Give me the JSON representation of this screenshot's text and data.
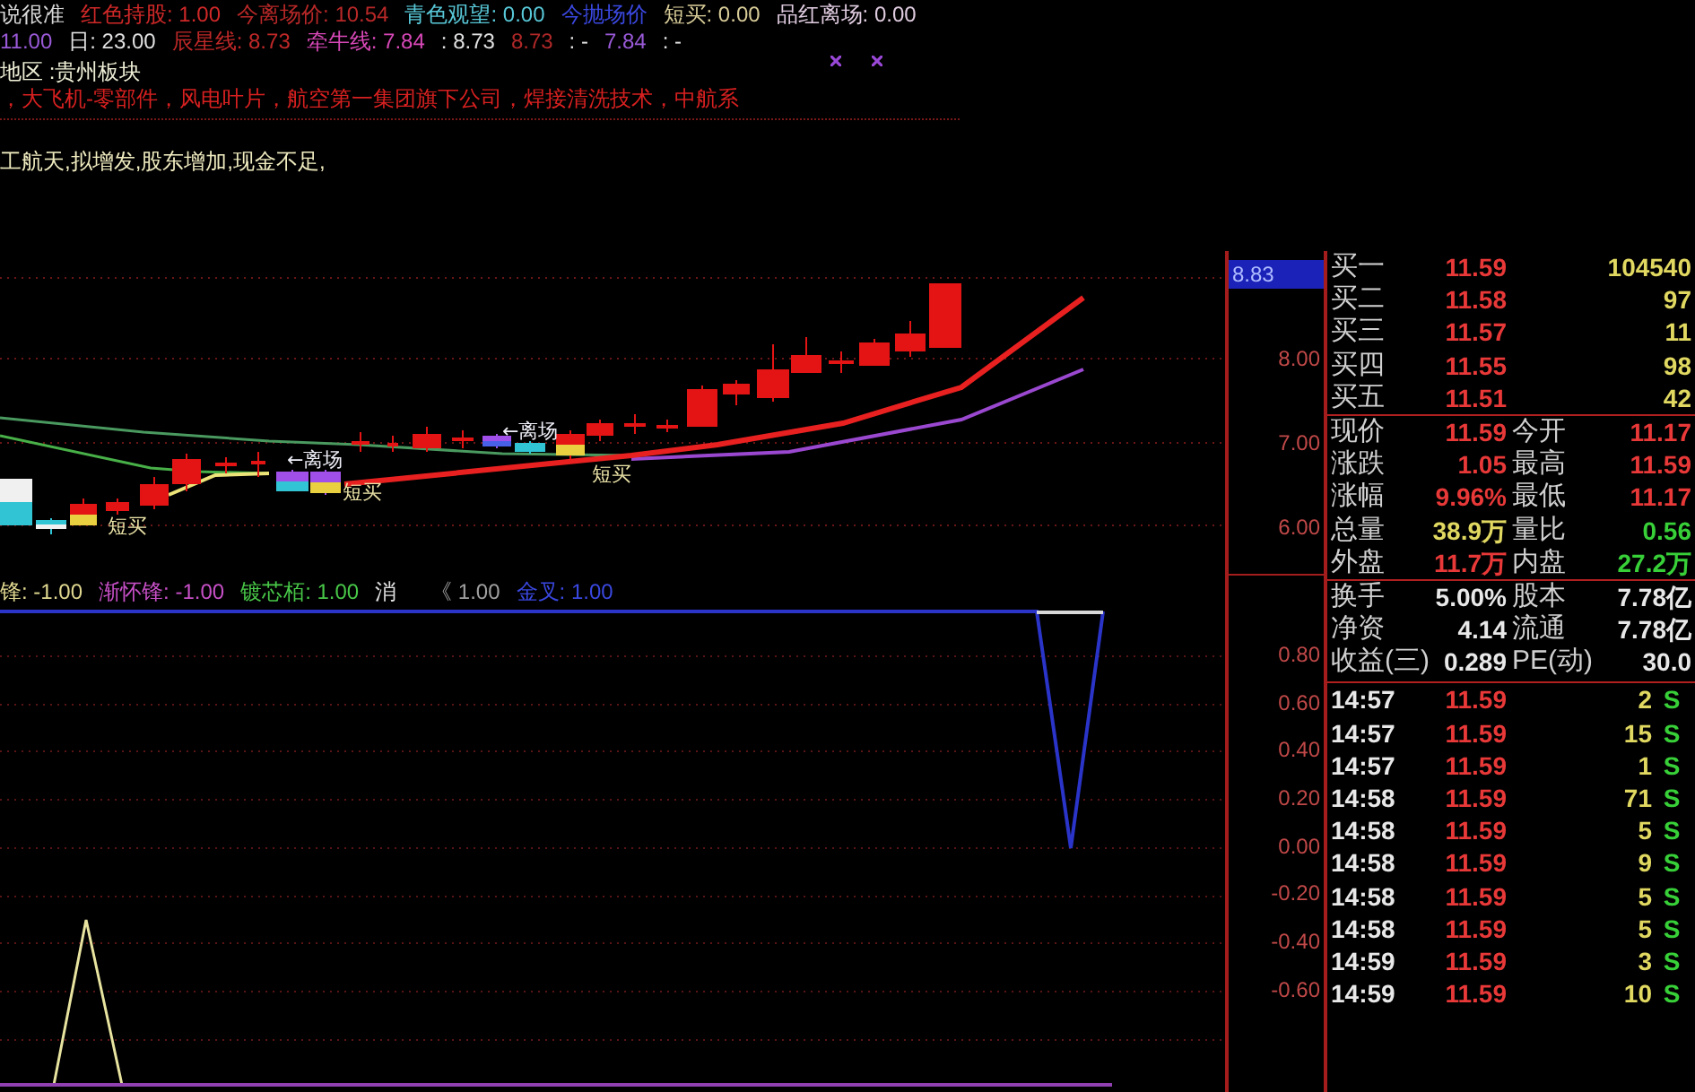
{
  "header_lines": [
    {
      "kind": "legend",
      "segments": [
        {
          "text": "说很准",
          "color": "#d8d8d8"
        },
        {
          "text": "红色持股: 1.00",
          "color": "#d02828"
        },
        {
          "text": "今离场价: 10.54",
          "color": "#b82828"
        },
        {
          "text": "青色观望: 0.00",
          "color": "#58c8d8"
        },
        {
          "text": "今抛场价",
          "color": "#3a48e0"
        },
        {
          "text": "短买: 0.00",
          "color": "#d8cc98"
        },
        {
          "text": "品红离场: 0.00",
          "color": "#e0cce0"
        }
      ]
    },
    {
      "kind": "legend",
      "segments": [
        {
          "text": "11.00",
          "color": "#9a5ad8"
        },
        {
          "text": "日: 23.00",
          "color": "#e0e0e0"
        },
        {
          "text": "辰星线: 8.73",
          "color": "#c02828"
        },
        {
          "text": "牵牛线: 7.84",
          "color": "#d848b8"
        },
        {
          "text": ": 8.73",
          "color": "#e0e0e0"
        },
        {
          "text": "8.73",
          "color": "#b02828"
        },
        {
          "text": ": -",
          "color": "#e0e0e0"
        },
        {
          "text": "7.84",
          "color": "#9a5ad8"
        },
        {
          "text": ": -",
          "color": "#e0e0e0"
        }
      ]
    },
    {
      "kind": "region",
      "segments": [
        {
          "text": "地区 :贵州板块",
          "color": "#f0f0d8"
        }
      ]
    },
    {
      "kind": "concepts",
      "segments": [
        {
          "text": "，大飞机-零部件，风电叶片，航空第一集团旗下公司，焊接清洗技术，中航系",
          "color": "#d82020"
        }
      ]
    },
    {
      "kind": "note",
      "segments": [
        {
          "text": "工航天,拟增发,股东增加,现金不足,",
          "color": "#f0ecc0"
        }
      ]
    }
  ],
  "price_chart": {
    "axis_ticks": [
      {
        "label": "8.83",
        "highlighted": true
      },
      {
        "label": "8.00",
        "highlighted": false
      },
      {
        "label": "7.00",
        "highlighted": false
      },
      {
        "label": "6.00",
        "highlighted": false
      }
    ],
    "annotations": [
      {
        "kind": "buy",
        "text": "短买"
      },
      {
        "kind": "exit",
        "text": "←离场"
      },
      {
        "kind": "buy",
        "text": "短买"
      },
      {
        "kind": "exit",
        "text": "←离场"
      },
      {
        "kind": "buy",
        "text": "短买"
      }
    ]
  },
  "indicator": {
    "legend": [
      {
        "text": "锋: -1.00",
        "color": "#e0d890"
      },
      {
        "text": "渐怀锋: -1.00",
        "color": "#c850c8"
      },
      {
        "text": "镀芯栢: 1.00",
        "color": "#48c848"
      },
      {
        "text": "消",
        "color": "#e0e0e0"
      },
      {
        "text": "《 1.00",
        "color": "#a0a0a0"
      },
      {
        "text": "金叉: 1.00",
        "color": "#3a48e0"
      }
    ],
    "axis_ticks": [
      "0.80",
      "0.60",
      "0.40",
      "0.20",
      "0.00",
      "-0.20",
      "-0.40",
      "-0.60"
    ]
  },
  "order_book": [
    {
      "label": "买一",
      "price": "11.59",
      "volume": "104540"
    },
    {
      "label": "买二",
      "price": "11.58",
      "volume": "97"
    },
    {
      "label": "买三",
      "price": "11.57",
      "volume": "11"
    },
    {
      "label": "买四",
      "price": "11.55",
      "volume": "98"
    },
    {
      "label": "买五",
      "price": "11.51",
      "volume": "42"
    }
  ],
  "quote_stats": [
    {
      "left": {
        "label": "现价",
        "value": "11.59",
        "color": "#e83838"
      },
      "right": {
        "label": "今开",
        "value": "11.17",
        "color": "#e83838"
      }
    },
    {
      "left": {
        "label": "涨跌",
        "value": "1.05",
        "color": "#e83838"
      },
      "right": {
        "label": "最高",
        "value": "11.59",
        "color": "#e83838"
      }
    },
    {
      "left": {
        "label": "涨幅",
        "value": "9.96%",
        "color": "#e83838"
      },
      "right": {
        "label": "最低",
        "value": "11.17",
        "color": "#e83838"
      }
    },
    {
      "left": {
        "label": "总量",
        "value": "38.9万",
        "color": "#e0d860"
      },
      "right": {
        "label": "量比",
        "value": "0.56",
        "color": "#38d038"
      }
    },
    {
      "left": {
        "label": "外盘",
        "value": "11.7万",
        "color": "#e83838"
      },
      "right": {
        "label": "内盘",
        "value": "27.2万",
        "color": "#38d038"
      }
    }
  ],
  "finance_stats": [
    {
      "left": {
        "label": "换手",
        "value": "5.00%",
        "color": "#e8e8e8"
      },
      "right": {
        "label": "股本",
        "value": "7.78亿",
        "color": "#e8e8e8"
      }
    },
    {
      "left": {
        "label": "净资",
        "value": "4.14",
        "color": "#e8e8e8"
      },
      "right": {
        "label": "流通",
        "value": "7.78亿",
        "color": "#e8e8e8"
      }
    },
    {
      "left": {
        "label": "收益(三)",
        "value": "0.289",
        "color": "#e8e8e8"
      },
      "right": {
        "label": "PE(动)",
        "value": "30.0",
        "color": "#e8e8e8"
      }
    }
  ],
  "trades": [
    {
      "time": "14:57",
      "price": "11.59",
      "volume": "2",
      "side": "S"
    },
    {
      "time": "14:57",
      "price": "11.59",
      "volume": "15",
      "side": "S"
    },
    {
      "time": "14:57",
      "price": "11.59",
      "volume": "1",
      "side": "S"
    },
    {
      "time": "14:58",
      "price": "11.59",
      "volume": "71",
      "side": "S"
    },
    {
      "time": "14:58",
      "price": "11.59",
      "volume": "5",
      "side": "S"
    },
    {
      "time": "14:58",
      "price": "11.59",
      "volume": "9",
      "side": "S"
    },
    {
      "time": "14:58",
      "price": "11.59",
      "volume": "5",
      "side": "S"
    },
    {
      "time": "14:58",
      "price": "11.59",
      "volume": "5",
      "side": "S"
    },
    {
      "time": "14:59",
      "price": "11.59",
      "volume": "3",
      "side": "S"
    },
    {
      "time": "14:59",
      "price": "11.59",
      "volume": "10",
      "side": "S"
    }
  ]
}
